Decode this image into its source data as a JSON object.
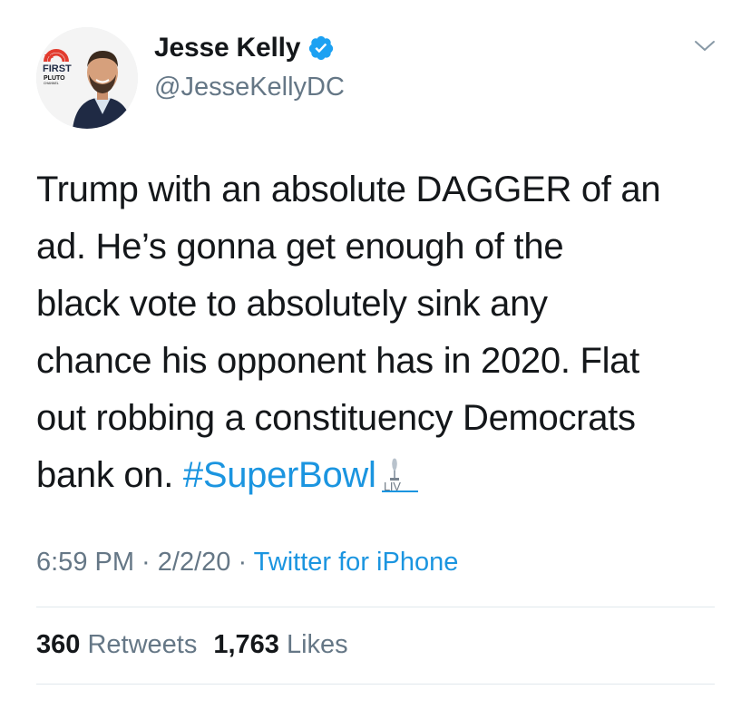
{
  "author": {
    "display_name": "Jesse Kelly",
    "handle": "@JesseKellyDC",
    "verified": true,
    "avatar_badge": {
      "line1": "THE",
      "line2": "FIRST",
      "line3": "PLUTO",
      "line4": "CHANNEL"
    }
  },
  "tweet": {
    "text_lines": [
      "Trump with an absolute DAGGER of an",
      "ad. He’s gonna get enough of the",
      "black vote to absolutely sink any",
      "chance his opponent has in 2020. Flat",
      "out robbing a constituency Democrats"
    ],
    "last_line_prefix": "bank on. ",
    "hashtag": "#SuperBowl",
    "hashflag_icon": "super-bowl-liv-trophy-icon"
  },
  "meta": {
    "time": "6:59 PM",
    "separator": " · ",
    "date": "2/2/20",
    "separator2": " · ",
    "source": "Twitter for iPhone"
  },
  "stats": {
    "retweets_count": "360",
    "retweets_label": "Retweets",
    "likes_count": "1,763",
    "likes_label": "Likes"
  },
  "colors": {
    "link_blue": "#1b95e0",
    "secondary_gray": "#657786",
    "text_dark": "#14171a",
    "verified_blue": "#1da1f2",
    "divider": "#e1e8ed"
  }
}
